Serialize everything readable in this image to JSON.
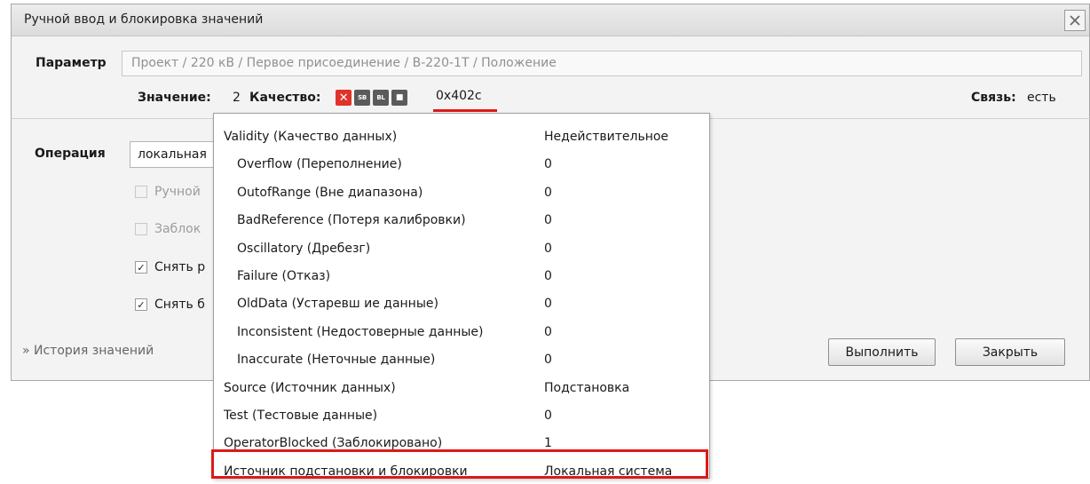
{
  "window": {
    "title": "Ручной ввод и блокировка значений"
  },
  "parameter": {
    "label": "Параметр",
    "path": "Проект / 220 кВ / Первое присоединение / В-220-1Т / Положение"
  },
  "status": {
    "value_label": "Значение:",
    "value": "2",
    "quality_label": "Качество:",
    "quality_icons": [
      {
        "icon": "invalid-x-icon",
        "text": "✕",
        "color": "#e0322b"
      },
      {
        "icon": "sb-icon",
        "text": "SB",
        "color": "#5b5b5b"
      },
      {
        "icon": "bl-icon",
        "text": "BL",
        "color": "#5b5b5b"
      },
      {
        "icon": "stop-icon",
        "text": "■",
        "color": "#5b5b5b"
      }
    ],
    "quality_code": "0x402c",
    "connection_label": "Связь:",
    "connection_value": "есть"
  },
  "operation": {
    "label": "Операция",
    "selected": "локальная"
  },
  "checkboxes": [
    {
      "label": "Ручной",
      "checked": false,
      "disabled": true
    },
    {
      "label": "Заблок",
      "checked": false,
      "disabled": true
    },
    {
      "label": "Снять р",
      "checked": true,
      "disabled": false
    },
    {
      "label": "Снять б",
      "checked": true,
      "disabled": false
    }
  ],
  "history_link": "» История значений",
  "buttons": {
    "execute": "Выполнить",
    "close": "Закрыть"
  },
  "quality_popup": {
    "rows": [
      {
        "key": "Validity (Качество данных)",
        "value": "Недействительное",
        "indent": false
      },
      {
        "key": "Overflow (Переполнение)",
        "value": "0",
        "indent": true
      },
      {
        "key": "OutofRange (Вне диапазона)",
        "value": "0",
        "indent": true
      },
      {
        "key": "BadReference (Потеря калибровки)",
        "value": "0",
        "indent": true
      },
      {
        "key": "Oscillatory (Дребезг)",
        "value": "0",
        "indent": true
      },
      {
        "key": "Failure (Отказ)",
        "value": "0",
        "indent": true
      },
      {
        "key": "OldData (Устаревш ие данные)",
        "value": "0",
        "indent": true
      },
      {
        "key": "Inconsistent (Недостоверные данные)",
        "value": "0",
        "indent": true
      },
      {
        "key": "Inaccurate (Неточные данные)",
        "value": "0",
        "indent": true
      },
      {
        "key": "Source (Источник данных)",
        "value": "Подстановка",
        "indent": false
      },
      {
        "key": "Test (Тестовые данные)",
        "value": "0",
        "indent": false
      },
      {
        "key": "OperatorBlocked (Заблокировано)",
        "value": "1",
        "indent": false
      },
      {
        "key": "Источник подстановки и блокировки",
        "value": "Локальная система",
        "indent": false
      }
    ]
  },
  "colors": {
    "highlight": "#e01818",
    "dialog_bg": "#f3f3f3",
    "popup_bg": "#ffffff"
  }
}
